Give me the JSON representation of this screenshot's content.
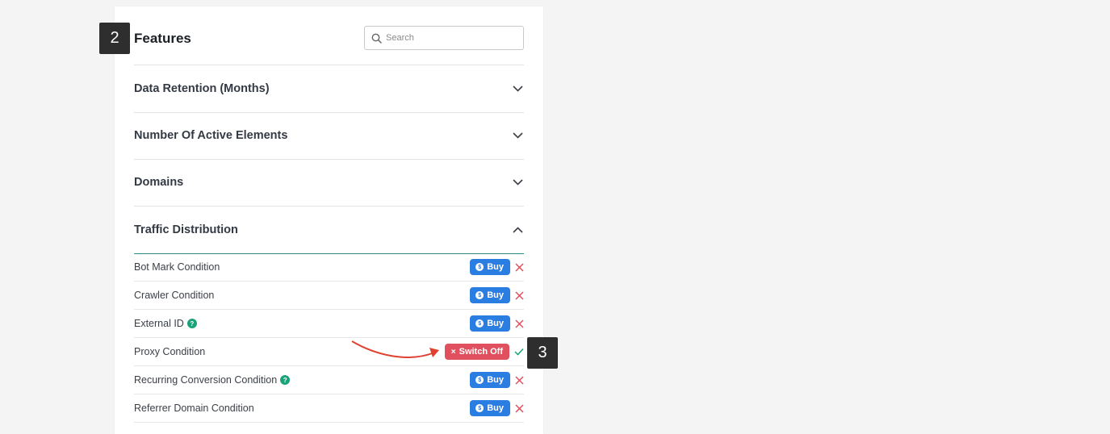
{
  "badges": {
    "step_2": "2",
    "step_3": "3"
  },
  "header": {
    "title": "Features",
    "search_placeholder": "Search"
  },
  "sections": [
    {
      "label": "Data Retention (Months)",
      "expanded": false
    },
    {
      "label": "Number Of Active Elements",
      "expanded": false
    },
    {
      "label": "Domains",
      "expanded": false
    },
    {
      "label": "Traffic Distribution",
      "expanded": true
    }
  ],
  "features": [
    {
      "label": "Bot Mark Condition",
      "action": "Buy",
      "status": "disabled"
    },
    {
      "label": "Crawler Condition",
      "action": "Buy",
      "status": "disabled"
    },
    {
      "label": "External ID",
      "help": "?",
      "action": "Buy",
      "status": "disabled"
    },
    {
      "label": "Proxy Condition",
      "action": "Switch Off",
      "action_icon": "×",
      "status": "enabled"
    },
    {
      "label": "Recurring Conversion Condition",
      "help": "?",
      "action": "Buy",
      "status": "disabled"
    },
    {
      "label": "Referrer Domain Condition",
      "action": "Buy",
      "status": "disabled"
    }
  ],
  "buy_icon": "$",
  "colors": {
    "buy": "#2a7de1",
    "switch_off": "#e0505f",
    "disabled_x": "#e0505f",
    "enabled_check": "#1aa37a",
    "annotation_arrow": "#e0402f"
  }
}
